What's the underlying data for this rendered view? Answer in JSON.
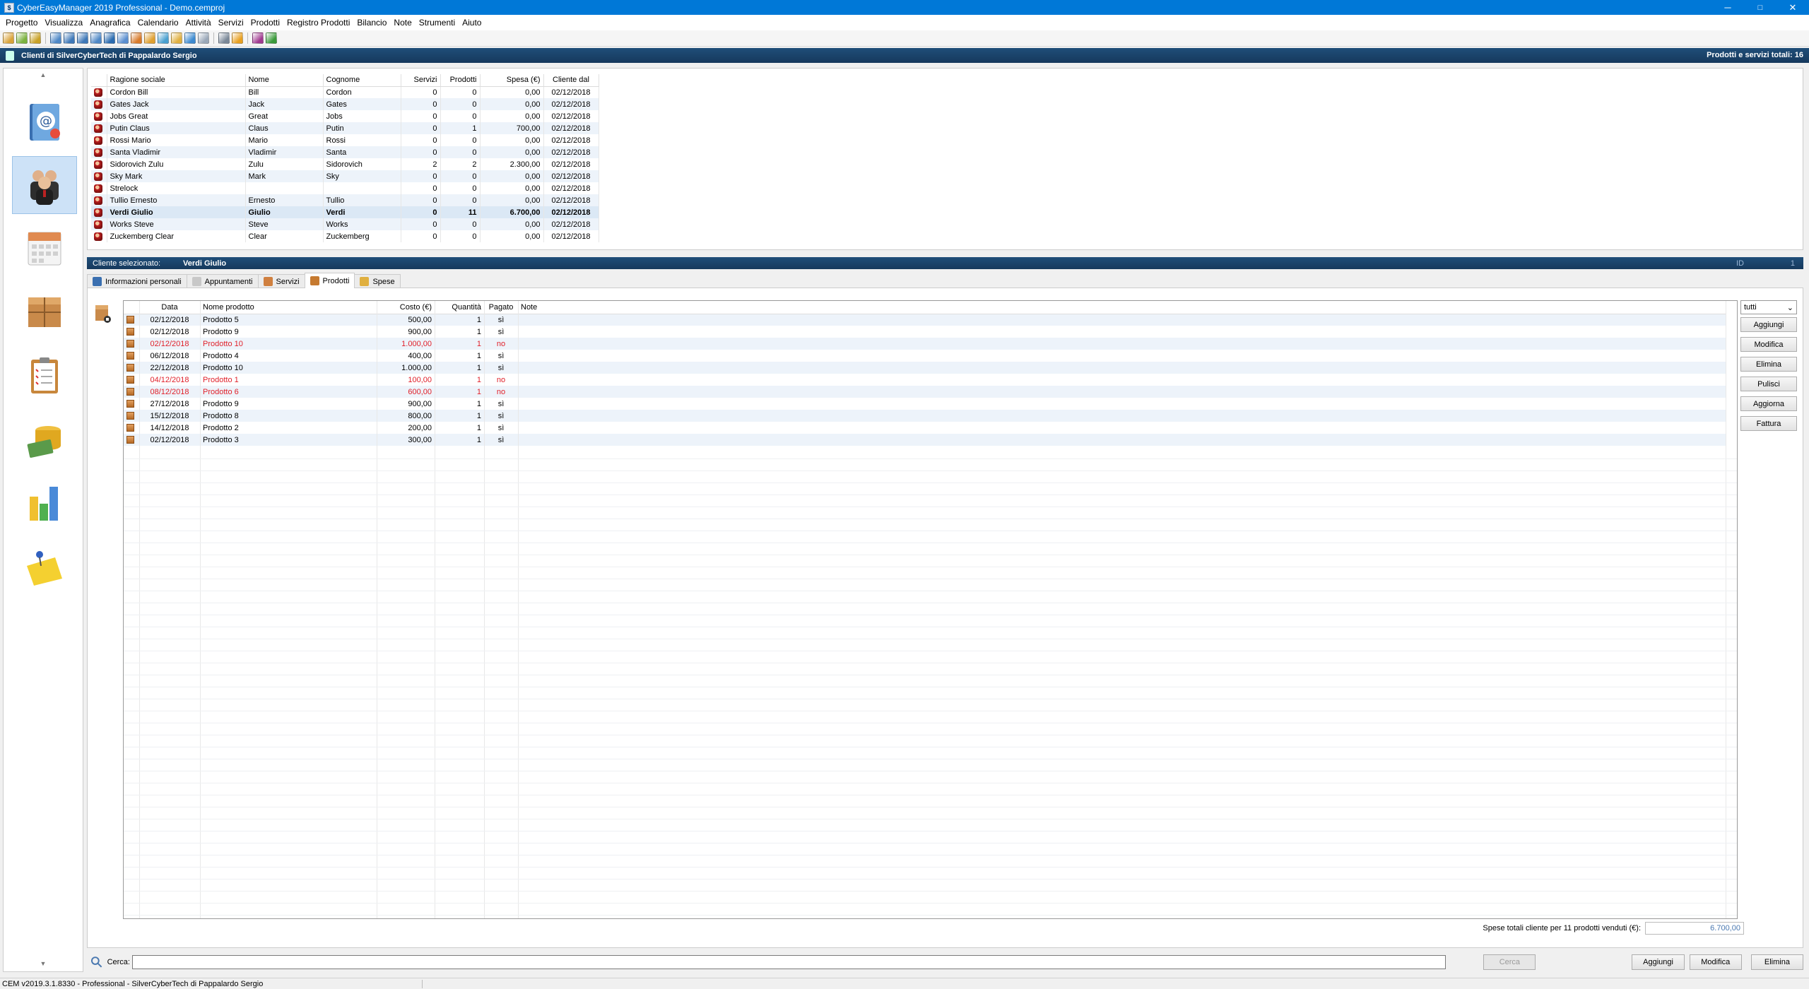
{
  "window": {
    "title": "CyberEasyManager 2019 Professional - Demo.cemproj",
    "controls": {
      "minimize": "─",
      "maximize": "□",
      "close": "✕"
    }
  },
  "menu": [
    "Progetto",
    "Visualizza",
    "Anagrafica",
    "Calendario",
    "Attività",
    "Servizi",
    "Prodotti",
    "Registro Prodotti",
    "Bilancio",
    "Note",
    "Strumenti",
    "Aiuto"
  ],
  "toolbar_colors": [
    "#d9a33a",
    "#7bb23f",
    "#c9a227",
    "#4f88c6",
    "#3e78b8",
    "#3e78b8",
    "#4f88c6",
    "#2a6bb0",
    "#5b8fd0",
    "#d87a2a",
    "#e0a030",
    "#4aa0d0",
    "#e0b040",
    "#3d8ad0",
    "#9aa8b8",
    "#7a8898",
    "#e8a020",
    "#a03a90",
    "#3a9a3a"
  ],
  "header": {
    "title": "Clienti di SilverCyberTech di Pappalardo Sergio",
    "right_text": "Prodotti e servizi totali: 16"
  },
  "nav": {
    "up_arrow": "▲",
    "down_arrow": "▼",
    "items": [
      {
        "icon": "address-book-icon"
      },
      {
        "icon": "clients-icon"
      },
      {
        "icon": "calendar-icon"
      },
      {
        "icon": "products-box-icon"
      },
      {
        "icon": "clipboard-icon"
      },
      {
        "icon": "money-coins-icon"
      },
      {
        "icon": "bar-chart-icon"
      },
      {
        "icon": "sticky-note-icon"
      }
    ]
  },
  "clients": {
    "columns": [
      "Ragione sociale",
      "Nome",
      "Cognome",
      "Servizi",
      "Prodotti",
      "Spesa (€)",
      "Cliente dal"
    ],
    "rows": [
      [
        "Cordon Bill",
        "Bill",
        "Cordon",
        "0",
        "0",
        "0,00",
        "02/12/2018"
      ],
      [
        "Gates Jack",
        "Jack",
        "Gates",
        "0",
        "0",
        "0,00",
        "02/12/2018"
      ],
      [
        "Jobs Great",
        "Great",
        "Jobs",
        "0",
        "0",
        "0,00",
        "02/12/2018"
      ],
      [
        "Putin Claus",
        "Claus",
        "Putin",
        "0",
        "1",
        "700,00",
        "02/12/2018"
      ],
      [
        "Rossi Mario",
        "Mario",
        "Rossi",
        "0",
        "0",
        "0,00",
        "02/12/2018"
      ],
      [
        "Santa Vladimir",
        "Vladimir",
        "Santa",
        "0",
        "0",
        "0,00",
        "02/12/2018"
      ],
      [
        "Sidorovich Zulu",
        "Zulu",
        "Sidorovich",
        "2",
        "2",
        "2.300,00",
        "02/12/2018"
      ],
      [
        "Sky Mark",
        "Mark",
        "Sky",
        "0",
        "0",
        "0,00",
        "02/12/2018"
      ],
      [
        "Strelock",
        "",
        "",
        "0",
        "0",
        "0,00",
        "02/12/2018"
      ],
      [
        "Tullio Ernesto",
        "Ernesto",
        "Tullio",
        "0",
        "0",
        "0,00",
        "02/12/2018"
      ],
      [
        "Verdi Giulio",
        "Giulio",
        "Verdi",
        "0",
        "11",
        "6.700,00",
        "02/12/2018"
      ],
      [
        "Works Steve",
        "Steve",
        "Works",
        "0",
        "0",
        "0,00",
        "02/12/2018"
      ],
      [
        "Zuckemberg Clear",
        "Clear",
        "Zuckemberg",
        "0",
        "0",
        "0,00",
        "02/12/2018"
      ]
    ],
    "selected_index": 10
  },
  "selected": {
    "label": "Cliente selezionato:",
    "name": "Verdi Giulio",
    "id_label": "ID",
    "id_value": "1"
  },
  "tabs": [
    {
      "label": "Informazioni personali",
      "color": "#3a6fb0"
    },
    {
      "label": "Appuntamenti",
      "color": "#c8c8c8"
    },
    {
      "label": "Servizi",
      "color": "#d08040"
    },
    {
      "label": "Prodotti",
      "color": "#c67a30"
    },
    {
      "label": "Spese",
      "color": "#e0b040"
    }
  ],
  "active_tab": 3,
  "products": {
    "columns": [
      "Data",
      "Nome prodotto",
      "Costo (€)",
      "Quantità",
      "Pagato",
      "Note"
    ],
    "rows": [
      {
        "data": "02/12/2018",
        "nome": "Prodotto 5",
        "costo": "500,00",
        "qta": "1",
        "pagato": "sì",
        "note": "",
        "unpaid": false
      },
      {
        "data": "02/12/2018",
        "nome": "Prodotto 9",
        "costo": "900,00",
        "qta": "1",
        "pagato": "sì",
        "note": "",
        "unpaid": false
      },
      {
        "data": "02/12/2018",
        "nome": "Prodotto 10",
        "costo": "1.000,00",
        "qta": "1",
        "pagato": "no",
        "note": "",
        "unpaid": true
      },
      {
        "data": "06/12/2018",
        "nome": "Prodotto 4",
        "costo": "400,00",
        "qta": "1",
        "pagato": "sì",
        "note": "",
        "unpaid": false
      },
      {
        "data": "22/12/2018",
        "nome": "Prodotto 10",
        "costo": "1.000,00",
        "qta": "1",
        "pagato": "sì",
        "note": "",
        "unpaid": false
      },
      {
        "data": "04/12/2018",
        "nome": "Prodotto 1",
        "costo": "100,00",
        "qta": "1",
        "pagato": "no",
        "note": "",
        "unpaid": true
      },
      {
        "data": "08/12/2018",
        "nome": "Prodotto 6",
        "costo": "600,00",
        "qta": "1",
        "pagato": "no",
        "note": "",
        "unpaid": true
      },
      {
        "data": "27/12/2018",
        "nome": "Prodotto 9",
        "costo": "900,00",
        "qta": "1",
        "pagato": "sì",
        "note": "",
        "unpaid": false
      },
      {
        "data": "15/12/2018",
        "nome": "Prodotto 8",
        "costo": "800,00",
        "qta": "1",
        "pagato": "sì",
        "note": "",
        "unpaid": false
      },
      {
        "data": "14/12/2018",
        "nome": "Prodotto 2",
        "costo": "200,00",
        "qta": "1",
        "pagato": "sì",
        "note": "",
        "unpaid": false
      },
      {
        "data": "02/12/2018",
        "nome": "Prodotto 3",
        "costo": "300,00",
        "qta": "1",
        "pagato": "sì",
        "note": "",
        "unpaid": false
      }
    ]
  },
  "filter": {
    "value": "tutti",
    "arrow": "⌄"
  },
  "side_buttons": [
    "Aggiungi",
    "Modifica",
    "Elimina",
    "Pulisci",
    "Aggiorna",
    "Fattura"
  ],
  "total": {
    "label": "Spese totali cliente per 11 prodotti venduti (€):",
    "value": "6.700,00"
  },
  "search": {
    "label": "Cerca:",
    "button": "Cerca",
    "placeholder": ""
  },
  "bottom_buttons": [
    "Aggiungi",
    "Modifica",
    "Elimina"
  ],
  "status": "CEM v2019.3.1.8330 - Professional - SilverCyberTech di Pappalardo Sergio",
  "colors": {
    "accent": "#0078d7",
    "header": "#1f4e79",
    "unpaid": "#e0202a",
    "alt_row": "#edf3fa"
  }
}
